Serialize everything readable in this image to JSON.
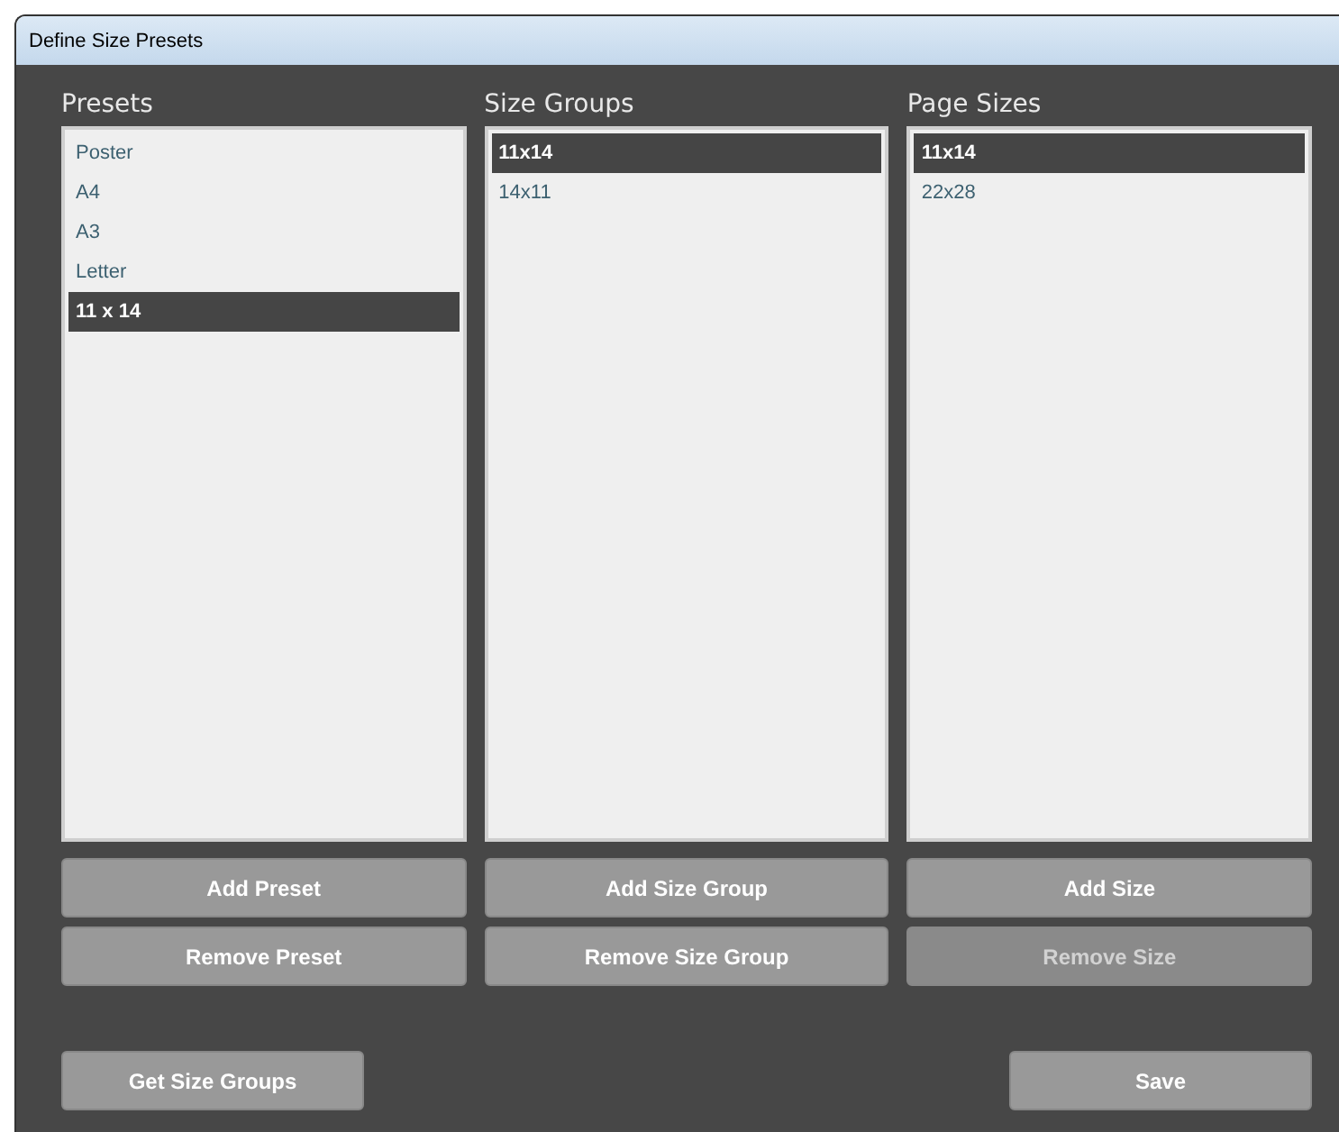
{
  "window": {
    "title": "Define Size Presets"
  },
  "columns": [
    {
      "title": "Presets",
      "items": [
        {
          "label": "Poster",
          "selected": false
        },
        {
          "label": "A4",
          "selected": false
        },
        {
          "label": "A3",
          "selected": false
        },
        {
          "label": "Letter",
          "selected": false
        },
        {
          "label": "11 x 14",
          "selected": true
        }
      ],
      "buttons": [
        {
          "label": "Add Preset",
          "disabled": false
        },
        {
          "label": "Remove Preset",
          "disabled": false
        }
      ]
    },
    {
      "title": "Size Groups",
      "items": [
        {
          "label": "11x14",
          "selected": true
        },
        {
          "label": "14x11",
          "selected": false
        }
      ],
      "buttons": [
        {
          "label": "Add Size Group",
          "disabled": false
        },
        {
          "label": "Remove Size Group",
          "disabled": false
        }
      ]
    },
    {
      "title": "Page Sizes",
      "items": [
        {
          "label": "11x14",
          "selected": true
        },
        {
          "label": "22x28",
          "selected": false
        }
      ],
      "buttons": [
        {
          "label": "Add Size",
          "disabled": false
        },
        {
          "label": "Remove Size",
          "disabled": true
        }
      ]
    }
  ],
  "footer_buttons": [
    {
      "label": "Get Size Groups",
      "disabled": false
    },
    {
      "label": "Save",
      "disabled": false
    }
  ]
}
